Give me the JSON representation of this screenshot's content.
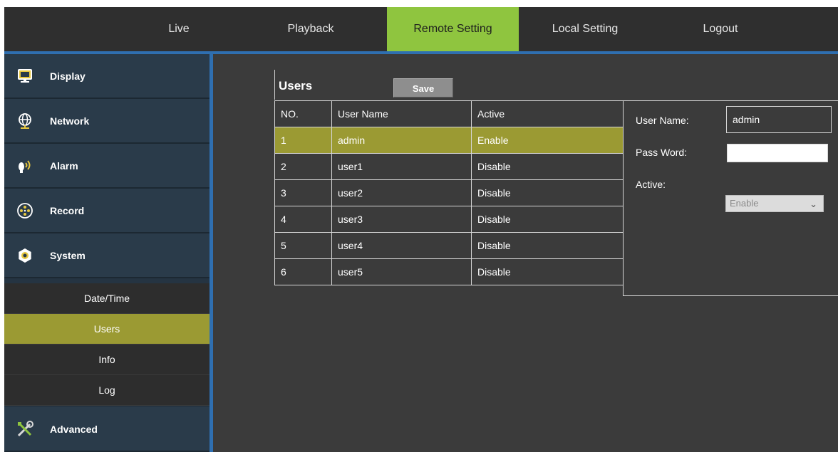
{
  "nav": {
    "items": [
      {
        "label": "Live"
      },
      {
        "label": "Playback"
      },
      {
        "label": "Remote Setting",
        "active": true
      },
      {
        "label": "Local Setting"
      },
      {
        "label": "Logout"
      }
    ]
  },
  "sidebar": {
    "items": [
      {
        "label": "Display",
        "icon": "monitor-icon"
      },
      {
        "label": "Network",
        "icon": "globe-network-icon"
      },
      {
        "label": "Alarm",
        "icon": "alarm-icon"
      },
      {
        "label": "Record",
        "icon": "film-reel-icon"
      },
      {
        "label": "System",
        "icon": "gear-nut-icon"
      },
      {
        "label": "Advanced",
        "icon": "tools-icon"
      }
    ],
    "system_sub": [
      {
        "label": "Date/Time"
      },
      {
        "label": "Users",
        "active": true
      },
      {
        "label": "Info"
      },
      {
        "label": "Log"
      }
    ]
  },
  "users": {
    "title": "Users",
    "save_label": "Save",
    "columns": [
      "NO.",
      "User Name",
      "Active"
    ],
    "rows": [
      [
        "1",
        "admin",
        "Enable"
      ],
      [
        "2",
        "user1",
        "Disable"
      ],
      [
        "3",
        "user2",
        "Disable"
      ],
      [
        "4",
        "user3",
        "Disable"
      ],
      [
        "5",
        "user4",
        "Disable"
      ],
      [
        "6",
        "user5",
        "Disable"
      ]
    ],
    "selected_row": 0
  },
  "detail": {
    "username_label": "User Name:",
    "username_value": "admin",
    "password_label": "Pass Word:",
    "password_value": "",
    "active_label": "Active:",
    "active_value": "Enable"
  },
  "colors": {
    "accent_green": "#8fc53f",
    "selection_olive": "#9b9a33",
    "divider_blue": "#2f6fb0"
  }
}
